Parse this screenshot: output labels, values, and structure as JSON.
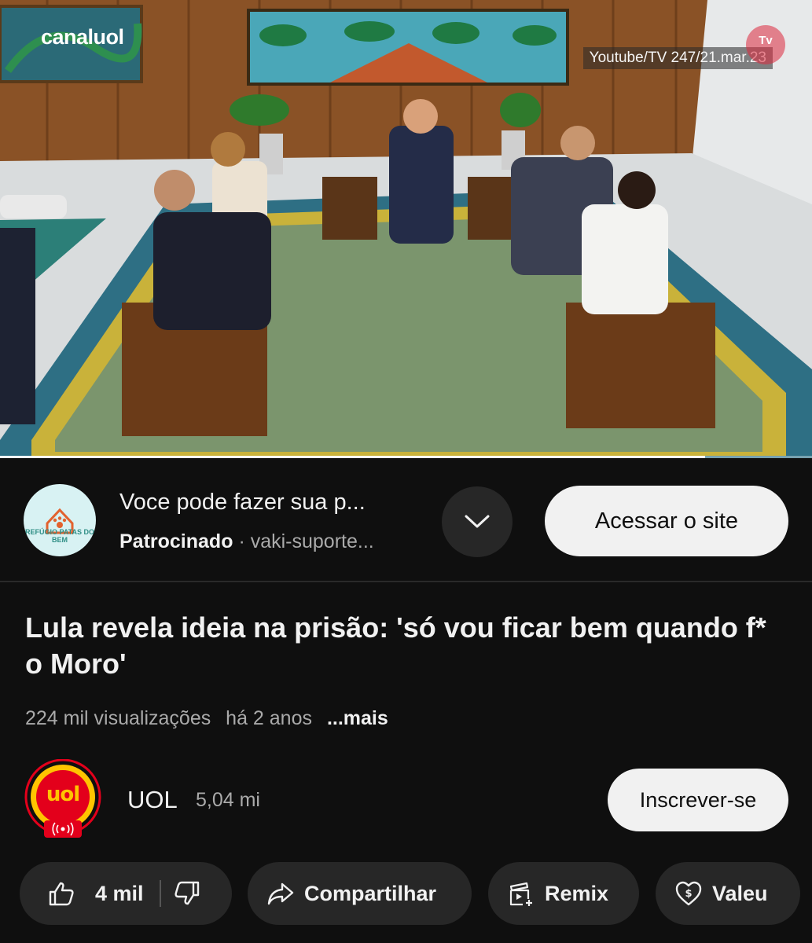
{
  "video": {
    "watermark_logo": "canal uol",
    "watermark_credit": "Youtube/TV 247/21.mar.23",
    "watermark_tv": "Tv",
    "progress_fraction": 0.868
  },
  "ad": {
    "logo_text": "REFÚGIO PATAS DO BEM",
    "title": "Voce pode fazer sua p...",
    "sponsored_label": "Patrocinado",
    "separator": "·",
    "advertiser": "vaki-suporte...",
    "cta_label": "Acessar o site",
    "expand_icon": "chevron-down-icon"
  },
  "video_info": {
    "title": "Lula revela ideia na prisão: 'só vou ficar bem quando f* o Moro'",
    "views": "224 mil visualizações",
    "age": "há 2 anos",
    "more_label": "...mais"
  },
  "channel": {
    "avatar_text": "uol",
    "name": "UOL",
    "subscribers": "5,04 mi",
    "subscribe_label": "Inscrever-se"
  },
  "actions": {
    "like_count": "4 mil",
    "share_label": "Compartilhar",
    "remix_label": "Remix",
    "thanks_label": "Valeu"
  },
  "colors": {
    "background": "#0f0f0f",
    "pill": "#272727",
    "primary_text": "#f1f1f1",
    "secondary_text": "#aaaaaa",
    "uol_red": "#e3001b",
    "uol_yellow": "#ffc400"
  }
}
